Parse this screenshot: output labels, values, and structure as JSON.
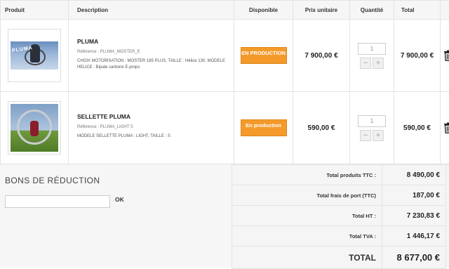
{
  "table": {
    "headers": {
      "product": "Produit",
      "description": "Description",
      "availability": "Disponible",
      "unit_price": "Prix unitaire",
      "quantity": "Quantité",
      "total": "Total"
    },
    "rows": [
      {
        "name": "PLUMA",
        "reference": "Référence : PLUMA_MOSTER_E",
        "options": "CHOIX MOTORISATION : MOSTER 185 PLUS, TAILLE : Hélice 130, MODELE HELICE : Bipale carbone E-props",
        "status": "EN PRODUCTION",
        "unit_price": "7 900,00 €",
        "quantity": "1",
        "total": "7 900,00 €",
        "image_label": "PLUMA",
        "icon": "trash-icon"
      },
      {
        "name": "SELLETTE PLUMA",
        "reference": "Référence : PLUMA_LIGHT S",
        "options": "MODELE SELLETTE PLUMA : LIGHT, TAILLE : S",
        "status": "En production",
        "unit_price": "590,00 €",
        "quantity": "1",
        "total": "590,00 €",
        "icon": "trash-icon"
      }
    ],
    "qty_minus": "−",
    "qty_plus": "+"
  },
  "voucher": {
    "title": "BONS DE RÉDUCTION",
    "input_value": "",
    "ok_label": "OK"
  },
  "totals": [
    {
      "label": "Total produits TTC :",
      "value": "8 490,00 €"
    },
    {
      "label": "Total frais de port (TTC)",
      "value": "187,00 €"
    },
    {
      "label": "Total HT :",
      "value": "7 230,83 €"
    },
    {
      "label": "Total TVA :",
      "value": "1 446,17 €"
    },
    {
      "label": "TOTAL",
      "value": "8 677,00 €"
    }
  ],
  "colors": {
    "status_badge": "#f39a2b",
    "header_bg": "#f6f6f6",
    "lower_bg": "#f5f5f5"
  }
}
